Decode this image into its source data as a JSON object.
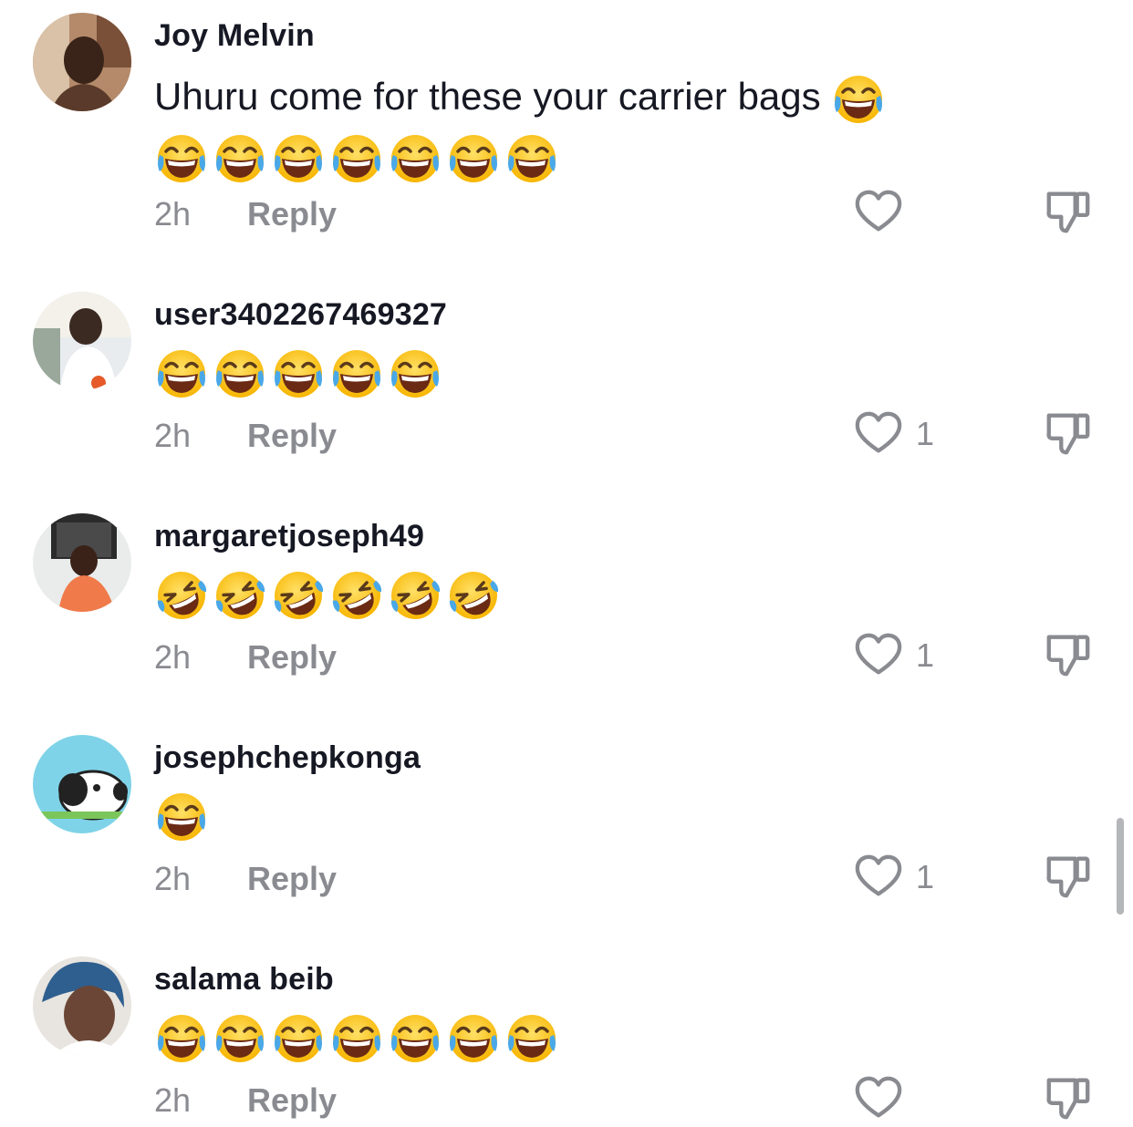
{
  "comments": [
    {
      "username": "Joy Melvin",
      "text": "Uhuru come for these your carrier bags",
      "emojis": [
        "tears-of-joy",
        "tears-of-joy",
        "tears-of-joy",
        "tears-of-joy",
        "tears-of-joy",
        "tears-of-joy",
        "tears-of-joy",
        "tears-of-joy"
      ],
      "time": "2h",
      "reply_label": "Reply",
      "likes": ""
    },
    {
      "username": "user3402267469327",
      "text": "",
      "emojis": [
        "tears-of-joy",
        "tears-of-joy",
        "tears-of-joy",
        "tears-of-joy",
        "tears-of-joy"
      ],
      "time": "2h",
      "reply_label": "Reply",
      "likes": "1"
    },
    {
      "username": "margaretjoseph49",
      "text": "",
      "emojis": [
        "rolling-laughing",
        "rolling-laughing",
        "rolling-laughing",
        "rolling-laughing",
        "rolling-laughing",
        "rolling-laughing"
      ],
      "time": "2h",
      "reply_label": "Reply",
      "likes": "1"
    },
    {
      "username": "josephchepkonga",
      "text": "",
      "emojis": [
        "tears-of-joy"
      ],
      "time": "2h",
      "reply_label": "Reply",
      "likes": "1"
    },
    {
      "username": "salama beib",
      "text": "",
      "emojis": [
        "tears-of-joy",
        "tears-of-joy",
        "tears-of-joy",
        "tears-of-joy",
        "tears-of-joy",
        "tears-of-joy",
        "tears-of-joy"
      ],
      "time": "2h",
      "reply_label": "Reply",
      "likes": ""
    }
  ],
  "icons": {
    "like": "heart-outline-icon",
    "dislike": "thumbs-down-icon"
  },
  "colors": {
    "text_primary": "#161823",
    "text_secondary": "#8a8b91",
    "emoji_yellow": "#ffcc33",
    "emoji_tear": "#4aa8e8"
  }
}
